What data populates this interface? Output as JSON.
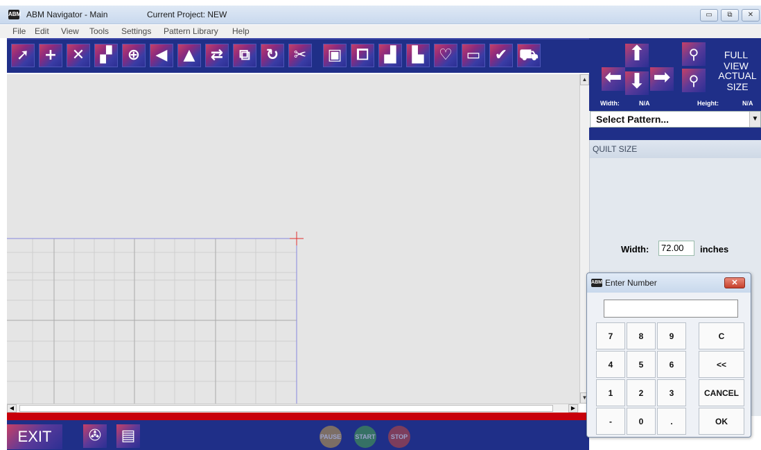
{
  "window": {
    "app_icon": "ABM",
    "title": "ABM Navigator - Main",
    "project": "Current Project: NEW",
    "buttons": [
      {
        "name": "minimize-button",
        "glyph": "▭"
      },
      {
        "name": "restore-button",
        "glyph": "⧉"
      },
      {
        "name": "close-button",
        "glyph": "✕"
      }
    ]
  },
  "menu": [
    "File",
    "Edit",
    "View",
    "Tools",
    "Settings",
    "Pattern Library",
    "Help"
  ],
  "toolbar": [
    {
      "name": "select-arrow-icon",
      "glyph": "➚"
    },
    {
      "name": "add-crosshair-icon",
      "glyph": "+"
    },
    {
      "name": "delete-x-icon",
      "glyph": "✕"
    },
    {
      "name": "block-icon",
      "glyph": "▞"
    },
    {
      "name": "target-icon",
      "glyph": "⊕"
    },
    {
      "name": "mirror-left-icon",
      "glyph": "◀"
    },
    {
      "name": "mirror-up-icon",
      "glyph": "▲"
    },
    {
      "name": "swap-arrows-icon",
      "glyph": "⇄"
    },
    {
      "name": "copy-icon",
      "glyph": "⧉"
    },
    {
      "name": "rotate-icon",
      "glyph": "↻"
    },
    {
      "name": "cut-icon",
      "glyph": "✂"
    },
    {
      "name": "grid-block-icon",
      "glyph": "▣"
    },
    {
      "name": "tile-icon",
      "glyph": "⧠"
    },
    {
      "name": "stairs-icon",
      "glyph": "▟"
    },
    {
      "name": "stairs-alt-icon",
      "glyph": "▙"
    },
    {
      "name": "heart-icon",
      "glyph": "♡"
    },
    {
      "name": "rectangle-icon",
      "glyph": "▭"
    },
    {
      "name": "checkmark-icon",
      "glyph": "✔"
    },
    {
      "name": "cart-icon",
      "glyph": "⛟"
    }
  ],
  "nav": {
    "full_view": "FULL VIEW",
    "actual_size": "ACTUAL SIZE",
    "width_label": "Width:",
    "width_value": "N/A",
    "height_label": "Height:",
    "height_value": "N/A"
  },
  "pattern_select": {
    "value": "Select Pattern..."
  },
  "quilt": {
    "header": "QUILT SIZE",
    "width_label": "Width:",
    "width_value": "72.00",
    "unit": "inches"
  },
  "bottom": {
    "exit": "EXIT",
    "pause": "PAUSE",
    "start": "START",
    "stop": "STOP"
  },
  "dialog": {
    "title": "Enter Number",
    "value": "",
    "keys": [
      [
        "7",
        "8",
        "9",
        "C"
      ],
      [
        "4",
        "5",
        "6",
        "<<"
      ],
      [
        "1",
        "2",
        "3",
        "CANCEL"
      ],
      [
        "-",
        "0",
        ".",
        "OK"
      ]
    ]
  },
  "colors": {
    "toolbar_blue": "#1f2f88",
    "progress_red": "#c8000c",
    "canvas_gray": "#e5e5e5"
  }
}
